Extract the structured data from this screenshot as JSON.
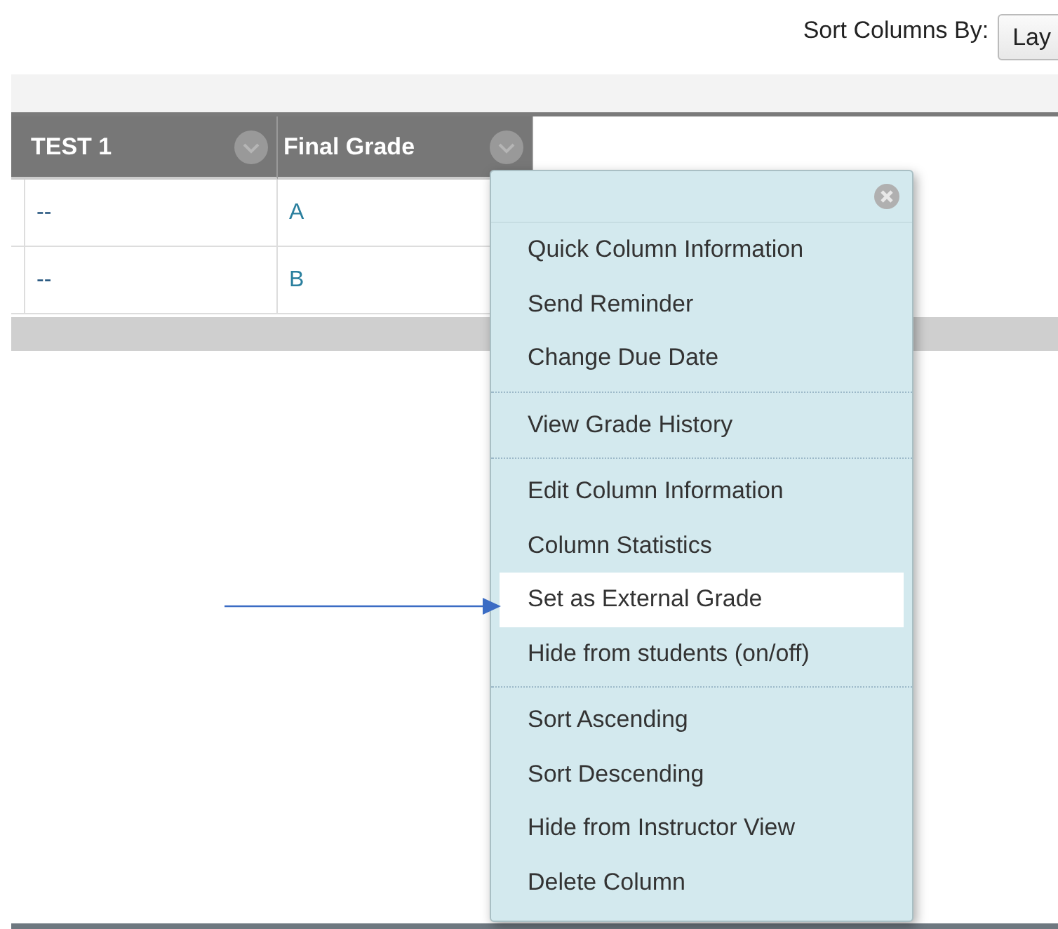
{
  "sort": {
    "label": "Sort Columns By:",
    "value": "Lay"
  },
  "table": {
    "columns": [
      {
        "label": "TEST 1"
      },
      {
        "label": "Final Grade"
      }
    ],
    "rows": [
      [
        "--",
        "A"
      ],
      [
        "--",
        "B"
      ]
    ]
  },
  "menu": {
    "groups": [
      [
        {
          "label": "Quick Column Information",
          "selected": false
        },
        {
          "label": "Send Reminder",
          "selected": false
        },
        {
          "label": "Change Due Date",
          "selected": false
        }
      ],
      [
        {
          "label": "View Grade History",
          "selected": false
        }
      ],
      [
        {
          "label": "Edit Column Information",
          "selected": false
        },
        {
          "label": "Column Statistics",
          "selected": false
        },
        {
          "label": "Set as External Grade",
          "selected": true
        },
        {
          "label": "Hide from students (on/off)",
          "selected": false
        }
      ],
      [
        {
          "label": "Sort Ascending",
          "selected": false
        },
        {
          "label": "Sort Descending",
          "selected": false
        },
        {
          "label": "Hide from Instructor View",
          "selected": false
        },
        {
          "label": "Delete Column",
          "selected": false
        }
      ]
    ]
  }
}
